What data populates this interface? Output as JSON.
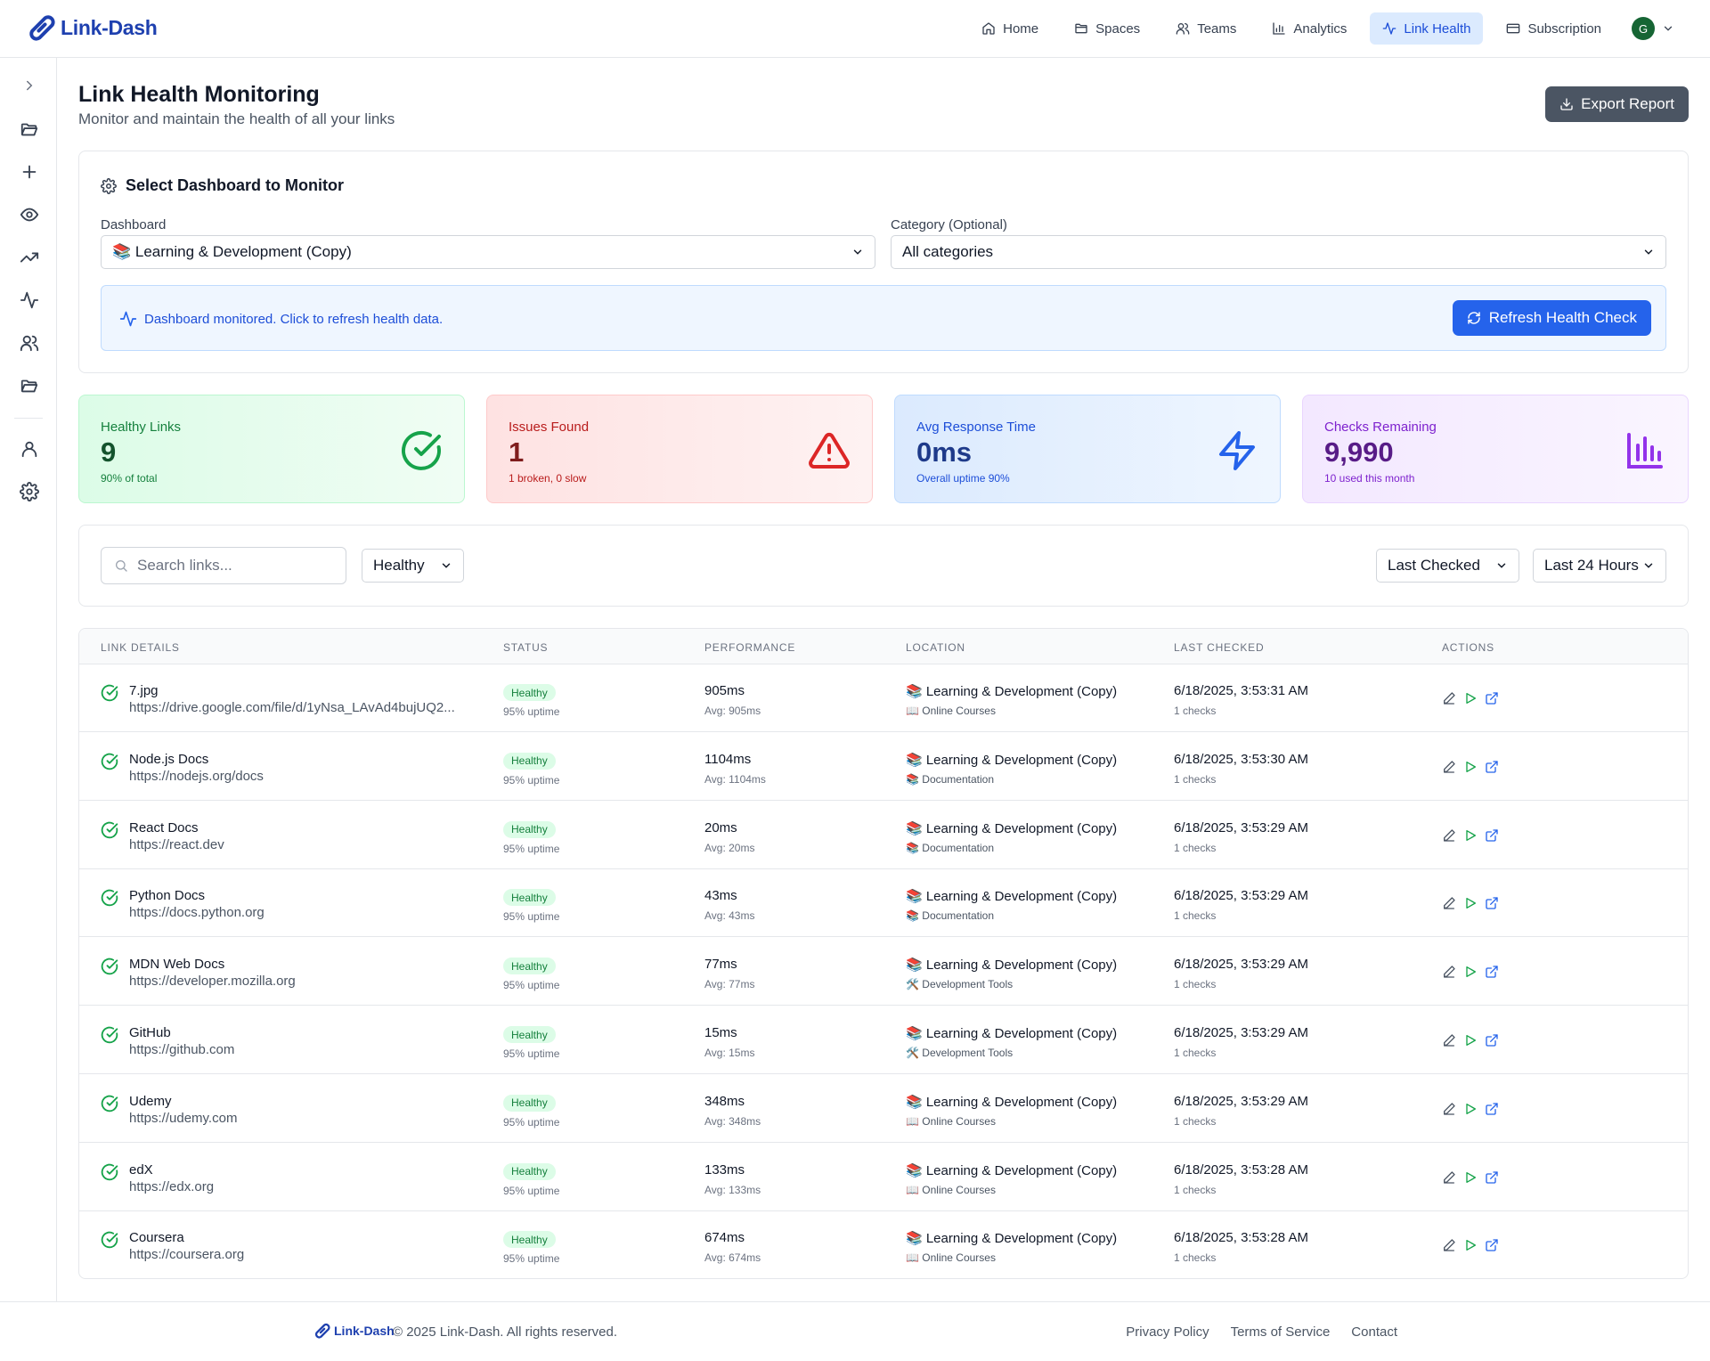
{
  "brand": {
    "name": "Link-Dash"
  },
  "nav": {
    "items": [
      {
        "label": "Home",
        "icon": "home-icon",
        "active": false
      },
      {
        "label": "Spaces",
        "icon": "folder-icon",
        "active": false
      },
      {
        "label": "Teams",
        "icon": "users-icon",
        "active": false
      },
      {
        "label": "Analytics",
        "icon": "bar-chart-icon",
        "active": false
      },
      {
        "label": "Link Health",
        "icon": "activity-icon",
        "active": true
      },
      {
        "label": "Subscription",
        "icon": "credit-card-icon",
        "active": false
      }
    ],
    "avatar_initial": "G"
  },
  "sidebar": {
    "icons": [
      "chevron-right-icon",
      "folder-open-icon",
      "plus-icon",
      "eye-icon",
      "trending-up-icon",
      "activity-icon",
      "users-icon",
      "folder-open-icon",
      "user-icon",
      "settings-icon"
    ]
  },
  "page": {
    "title": "Link Health Monitoring",
    "subtitle": "Monitor and maintain the health of all your links",
    "export_label": "Export Report"
  },
  "selector": {
    "title": "Select Dashboard to Monitor",
    "dashboard_label": "Dashboard",
    "dashboard_value": "📚 Learning & Development (Copy)",
    "category_label": "Category (Optional)",
    "category_value": "All categories",
    "info_text": "Dashboard monitored. Click to refresh health data.",
    "refresh_label": "Refresh Health Check"
  },
  "stats": {
    "healthy": {
      "label": "Healthy Links",
      "value": "9",
      "sub": "90% of total"
    },
    "issues": {
      "label": "Issues Found",
      "value": "1",
      "sub": "1 broken, 0 slow"
    },
    "response": {
      "label": "Avg Response Time",
      "value": "0ms",
      "sub": "Overall uptime 90%"
    },
    "checks": {
      "label": "Checks Remaining",
      "value": "9,990",
      "sub": "10 used this month"
    }
  },
  "filters": {
    "search_placeholder": "Search links...",
    "status_value": "Healthy",
    "sort_value": "Last Checked",
    "range_value": "Last 24 Hours"
  },
  "table": {
    "headers": [
      "LINK DETAILS",
      "STATUS",
      "PERFORMANCE",
      "LOCATION",
      "LAST CHECKED",
      "ACTIONS"
    ],
    "rows": [
      {
        "name": "7.jpg",
        "url": "https://drive.google.com/file/d/1yNsa_LAvAd4bujUQ2...",
        "status": "Healthy",
        "uptime": "95% uptime",
        "ms": "905ms",
        "avg": "Avg: 905ms",
        "location": "📚 Learning & Development (Copy)",
        "category": "📖 Online Courses",
        "time": "6/18/2025, 3:53:31 AM",
        "checks": "1 checks"
      },
      {
        "name": "Node.js Docs",
        "url": "https://nodejs.org/docs",
        "status": "Healthy",
        "uptime": "95% uptime",
        "ms": "1104ms",
        "avg": "Avg: 1104ms",
        "location": "📚 Learning & Development (Copy)",
        "category": "📚 Documentation",
        "time": "6/18/2025, 3:53:30 AM",
        "checks": "1 checks"
      },
      {
        "name": "React Docs",
        "url": "https://react.dev",
        "status": "Healthy",
        "uptime": "95% uptime",
        "ms": "20ms",
        "avg": "Avg: 20ms",
        "location": "📚 Learning & Development (Copy)",
        "category": "📚 Documentation",
        "time": "6/18/2025, 3:53:29 AM",
        "checks": "1 checks"
      },
      {
        "name": "Python Docs",
        "url": "https://docs.python.org",
        "status": "Healthy",
        "uptime": "95% uptime",
        "ms": "43ms",
        "avg": "Avg: 43ms",
        "location": "📚 Learning & Development (Copy)",
        "category": "📚 Documentation",
        "time": "6/18/2025, 3:53:29 AM",
        "checks": "1 checks"
      },
      {
        "name": "MDN Web Docs",
        "url": "https://developer.mozilla.org",
        "status": "Healthy",
        "uptime": "95% uptime",
        "ms": "77ms",
        "avg": "Avg: 77ms",
        "location": "📚 Learning & Development (Copy)",
        "category": "🛠️ Development Tools",
        "time": "6/18/2025, 3:53:29 AM",
        "checks": "1 checks"
      },
      {
        "name": "GitHub",
        "url": "https://github.com",
        "status": "Healthy",
        "uptime": "95% uptime",
        "ms": "15ms",
        "avg": "Avg: 15ms",
        "location": "📚 Learning & Development (Copy)",
        "category": "🛠️ Development Tools",
        "time": "6/18/2025, 3:53:29 AM",
        "checks": "1 checks"
      },
      {
        "name": "Udemy",
        "url": "https://udemy.com",
        "status": "Healthy",
        "uptime": "95% uptime",
        "ms": "348ms",
        "avg": "Avg: 348ms",
        "location": "📚 Learning & Development (Copy)",
        "category": "📖 Online Courses",
        "time": "6/18/2025, 3:53:29 AM",
        "checks": "1 checks"
      },
      {
        "name": "edX",
        "url": "https://edx.org",
        "status": "Healthy",
        "uptime": "95% uptime",
        "ms": "133ms",
        "avg": "Avg: 133ms",
        "location": "📚 Learning & Development (Copy)",
        "category": "📖 Online Courses",
        "time": "6/18/2025, 3:53:28 AM",
        "checks": "1 checks"
      },
      {
        "name": "Coursera",
        "url": "https://coursera.org",
        "status": "Healthy",
        "uptime": "95% uptime",
        "ms": "674ms",
        "avg": "Avg: 674ms",
        "location": "📚 Learning & Development (Copy)",
        "category": "📖 Online Courses",
        "time": "6/18/2025, 3:53:28 AM",
        "checks": "1 checks"
      }
    ]
  },
  "footer": {
    "brand": "Link-Dash",
    "copyright": "© 2025 Link-Dash. All rights reserved.",
    "links": [
      "Privacy Policy",
      "Terms of Service",
      "Contact"
    ]
  },
  "colors": {
    "primary": "#2563eb",
    "brand": "#1e40af",
    "healthy": "#16a34a",
    "danger": "#dc2626",
    "purple": "#9333ea"
  }
}
